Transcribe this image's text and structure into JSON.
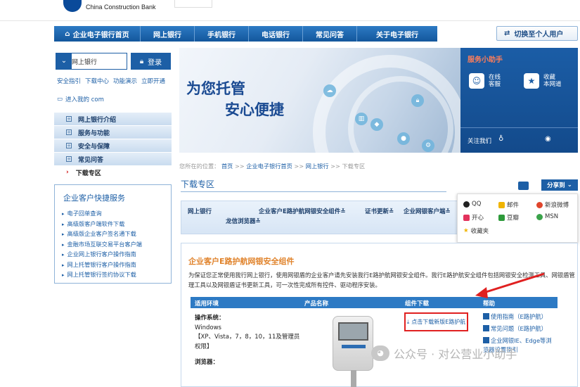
{
  "header": {
    "bank_name": "China Construction Bank"
  },
  "nav": {
    "items": [
      "企业电子银行首页",
      "网上银行",
      "手机银行",
      "电话银行",
      "常见问答",
      "关于电子银行"
    ],
    "switch_label": "切换至个人用户"
  },
  "login": {
    "select_value": "企业网上银行",
    "login_label": "登录",
    "links": [
      "安全指引",
      "下载中心",
      "功能演示",
      "立即开通"
    ],
    "mycom": "进入我的 com"
  },
  "sidemenu": {
    "items": [
      "网上银行介绍",
      "服务与功能",
      "安全与保障",
      "常见问答"
    ],
    "active": "下载专区"
  },
  "quick": {
    "title": "企业客户快捷服务",
    "items": [
      "电子回单查询",
      "高级版客户端软件下载",
      "高级版企业客户签名通下载",
      "金融市场互联交易平台客户端",
      "企业网上银行客户操作指南",
      "网上托管银行客户操作指南",
      "网上托管银行签约协议下载"
    ]
  },
  "banner": {
    "line1": "为您托管",
    "line2": "安心便捷"
  },
  "helper": {
    "title": "服务小助手",
    "online_1": "在线",
    "online_2": "客服",
    "fav_1": "收藏",
    "fav_2": "本网道",
    "follow": "关注我们"
  },
  "breadcrumb": {
    "prefix": "您所在的位置：",
    "home": "首页",
    "l1": "企业电子银行首页",
    "l2": "网上银行",
    "current": "下载专区",
    "sep": ">>"
  },
  "page_title": "下载专区",
  "share": {
    "label": "分享到",
    "items": [
      "QQ",
      "邮件",
      "新浪微博",
      "开心",
      "豆瓣",
      "MSN",
      "收藏夹"
    ]
  },
  "tabs": {
    "net": "网上银行",
    "e_lu": "企业客户E路护航网银安全组件",
    "cert": "证书更新",
    "ops": "企业网银客户端",
    "browser": "龙信浏览器"
  },
  "panel": {
    "title": "企业客户E路护航网银安全组件",
    "description": "为保证您正常使用我行网上银行，使用网银盾的企业客户请先安装我行E路护航网银安全组件。我行E路护航安全组件包括网银安全检测工具、网银盾管理工具以及网银盾证书更新工具，可一次性完成所有控件、驱动程序安装。",
    "headers": [
      "适用环境",
      "产品名称",
      "组件下载",
      "帮助"
    ],
    "os_label": "操作系统：",
    "os_value": "Windows",
    "os_versions": "【XP、Vista，7，8，10，11及管理员权限】",
    "browser_label": "浏览器：",
    "download_label": "点击下载新版E路护航",
    "help_1": "使用指南（E路护航）",
    "help_2": "常见问题（E路护航）",
    "help_3": "企业网银IE、Edge等浏览器设置指引"
  },
  "watermark": {
    "text": "公众号 · 对公营业小助手"
  }
}
